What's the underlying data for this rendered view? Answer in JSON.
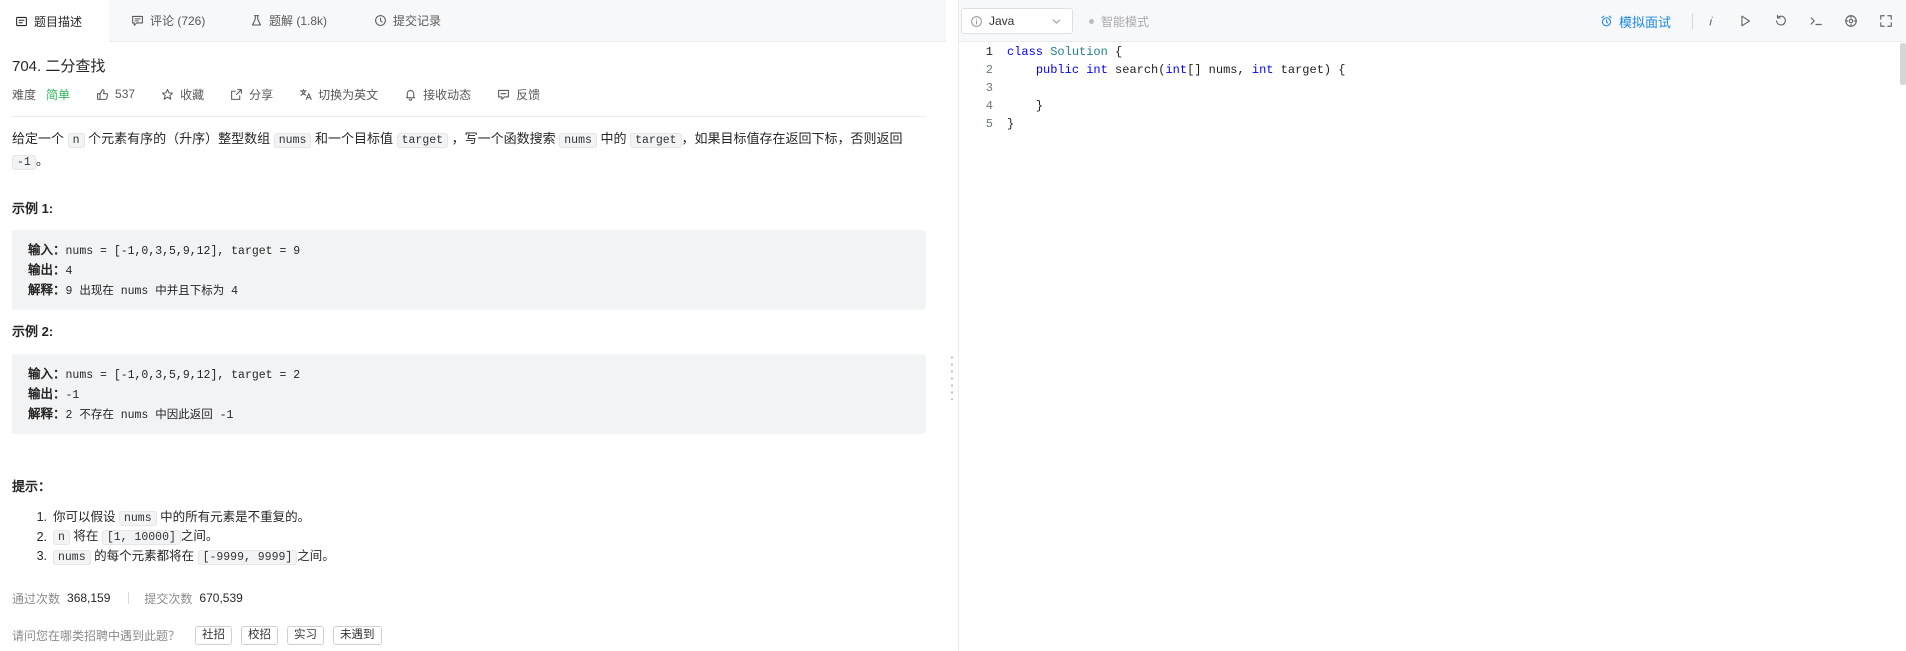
{
  "tabs": [
    {
      "label": "题目描述",
      "icon": "description-icon",
      "active": true
    },
    {
      "label": "评论 (726)",
      "icon": "comment-icon"
    },
    {
      "label": "题解 (1.8k)",
      "icon": "flask-icon"
    },
    {
      "label": "提交记录",
      "icon": "history-icon"
    }
  ],
  "problem": {
    "title": "704. 二分查找",
    "difficulty_label": "难度",
    "difficulty": "简单",
    "likes": "537",
    "actions": [
      {
        "label": "收藏",
        "icon": "star-icon"
      },
      {
        "label": "分享",
        "icon": "share-icon"
      },
      {
        "label": "切换为英文",
        "icon": "translate-icon"
      },
      {
        "label": "接收动态",
        "icon": "bell-icon"
      },
      {
        "label": "反馈",
        "icon": "feedback-icon"
      }
    ]
  },
  "description": [
    {
      "text": "给定一个 "
    },
    {
      "code": "n"
    },
    {
      "text": " 个元素有序的（升序）整型数组 "
    },
    {
      "code": "nums"
    },
    {
      "text": " 和一个目标值 "
    },
    {
      "code": "target"
    },
    {
      "text": " ，写一个函数搜索 "
    },
    {
      "code": "nums"
    },
    {
      "text": " 中的 "
    },
    {
      "code": "target"
    },
    {
      "text": "，如果目标值存在返回下标，否则返回 "
    },
    {
      "code": "-1"
    },
    {
      "text": "。"
    }
  ],
  "examples": [
    {
      "title": "示例 1:",
      "lines": [
        {
          "label": "输入：",
          "value": "nums = [-1,0,3,5,9,12], target = 9"
        },
        {
          "label": "输出：",
          "value": "4"
        },
        {
          "label": "解释：",
          "value": "9 出现在 nums 中并且下标为 4"
        }
      ]
    },
    {
      "title": "示例 2:",
      "lines": [
        {
          "label": "输入：",
          "value": "nums = [-1,0,3,5,9,12], target = 2"
        },
        {
          "label": "输出：",
          "value": "-1"
        },
        {
          "label": "解释：",
          "value": "2 不存在 nums 中因此返回 -1"
        }
      ]
    }
  ],
  "hints": {
    "title": "提示：",
    "markers": [
      "1.",
      "2.",
      "3."
    ],
    "items": [
      [
        {
          "text": "你可以假设 "
        },
        {
          "code": "nums"
        },
        {
          "text": " 中的所有元素是不重复的。"
        }
      ],
      [
        {
          "code": "n"
        },
        {
          "text": " 将在 "
        },
        {
          "code": "[1, 10000]"
        },
        {
          "text": "之间。"
        }
      ],
      [
        {
          "code": "nums"
        },
        {
          "text": " 的每个元素都将在 "
        },
        {
          "code": "[-9999, 9999]"
        },
        {
          "text": "之间。"
        }
      ]
    ]
  },
  "stats": {
    "accepted_label": "通过次数",
    "accepted": "368,159",
    "submissions_label": "提交次数",
    "submissions": "670,539"
  },
  "survey": {
    "question": "请问您在哪类招聘中遇到此题？",
    "options": [
      "社招",
      "校招",
      "实习",
      "未遇到"
    ]
  },
  "editor": {
    "language": "Java",
    "smart_mode": "智能模式",
    "mock_interview": "模拟面试",
    "toolbar_icons": [
      "alarm-icon",
      "info-icon",
      "run-icon",
      "reset-icon",
      "console-icon",
      "settings-icon",
      "fullscreen-icon"
    ],
    "line_numbers": [
      "1",
      "2",
      "3",
      "4",
      "5"
    ],
    "code": [
      [
        {
          "kw": "class"
        },
        {
          "text": " "
        },
        {
          "cls": "Solution"
        },
        {
          "text": " {"
        }
      ],
      [
        {
          "text": "    "
        },
        {
          "kw": "public"
        },
        {
          "text": " "
        },
        {
          "kw": "int"
        },
        {
          "text": " search("
        },
        {
          "kw": "int"
        },
        {
          "text": "[] nums, "
        },
        {
          "kw": "int"
        },
        {
          "text": " target) {"
        }
      ],
      [],
      [
        {
          "text": "    }"
        }
      ],
      [
        {
          "text": "}"
        }
      ]
    ]
  },
  "colors": {
    "accent": "#1e88e5",
    "easy": "#2db55d",
    "keyword": "#0000ff",
    "class_name": "#267f99",
    "text": "#262626",
    "muted": "#8c8c8c"
  }
}
